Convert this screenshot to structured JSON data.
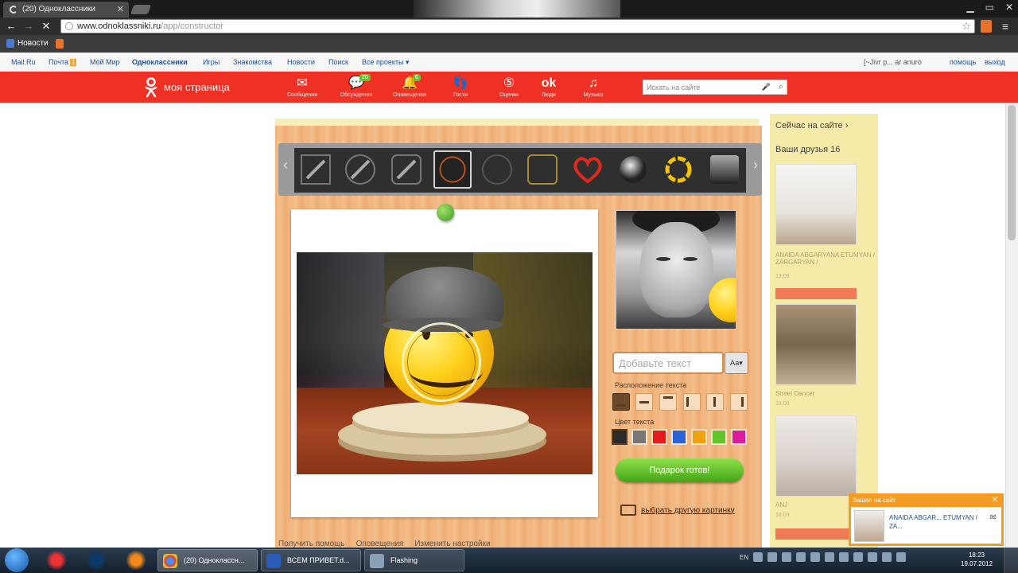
{
  "browser": {
    "tab_title": "(20) Одноклассники",
    "url_host": "www.odnoklassniki.ru",
    "url_path": "/app/constructor",
    "bookmark_news": "Новости"
  },
  "portal": {
    "links": [
      "Mail.Ru",
      "Почта",
      "Мой Мир",
      "Одноклассники",
      "Игры",
      "Знакомства",
      "Новости",
      "Поиск",
      "Все проекты ▾"
    ],
    "mail_badge": "1",
    "user": "[~Jivr р... ar anuro",
    "help": "помощь",
    "logout": "выход"
  },
  "ok": {
    "title": "моя страница",
    "nav": [
      {
        "label": "Сообщения",
        "icon": "✉",
        "badge": ""
      },
      {
        "label": "Обсуждения",
        "icon": "💬",
        "badge": "20"
      },
      {
        "label": "Оповещения",
        "icon": "🔔",
        "badge": "6"
      },
      {
        "label": "Гости",
        "icon": "👣",
        "badge": ""
      },
      {
        "label": "Оценки",
        "icon": "⑤",
        "badge": ""
      },
      {
        "label": "Люди",
        "icon": "ok",
        "badge": ""
      },
      {
        "label": "Музыка",
        "icon": "♫",
        "badge": ""
      }
    ],
    "search_placeholder": "Искать на сайте"
  },
  "constructor": {
    "text_placeholder": "Добавьте текст",
    "font_button": "Аа▾",
    "position_label": "Расположение текста",
    "color_label": "Цвет текста",
    "colors": [
      "#2a2a2a",
      "#777777",
      "#e31b1b",
      "#2a62d9",
      "#f0a112",
      "#5fc52a",
      "#d81e9f"
    ],
    "ready_button": "Подарок готов!",
    "other_picture": "выбрать другую картинку",
    "bottom_links": [
      "Получить помощь",
      "Оповещения",
      "Изменить настройки"
    ]
  },
  "right": {
    "now_on_site": "Сейчас на сайте ›",
    "friends": "Ваши друзья 16",
    "friend1_name": "ANAIDA ABGARYANA ETUMYAN / ZARGARYAN /",
    "friend1_time": "13:08",
    "friend2_name": "Street Dancer",
    "friend2_time": "18:08",
    "friend3_name": "ANJ",
    "friend3_time": "18:09"
  },
  "toast": {
    "head": "Зашел на сайт",
    "name": "ANAIDA ABGAR... ETUMYAN / ZA..."
  },
  "taskbar": {
    "tasks": [
      "(20) Одноклассн...",
      "ВСЕМ ПРИВЕТ.d...",
      "Flashing"
    ],
    "lang": "EN",
    "time": "18:23",
    "date": "19.07.2012"
  }
}
